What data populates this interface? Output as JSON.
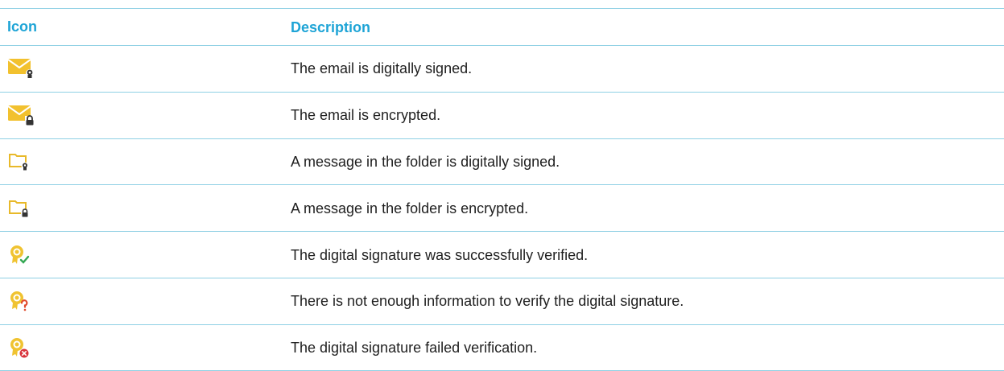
{
  "table": {
    "headers": {
      "icon": "Icon",
      "description": "Description"
    },
    "rows": [
      {
        "icon": "email-signed-icon",
        "description": "The email is digitally signed."
      },
      {
        "icon": "email-encrypted-icon",
        "description": "The email is encrypted."
      },
      {
        "icon": "folder-signed-icon",
        "description": "A message in the folder is digitally signed."
      },
      {
        "icon": "folder-encrypted-icon",
        "description": "A message in the folder is encrypted."
      },
      {
        "icon": "signature-verified-icon",
        "description": "The digital signature was successfully verified."
      },
      {
        "icon": "signature-unknown-icon",
        "description": "There is not enough information to verify the digital signature."
      },
      {
        "icon": "signature-failed-icon",
        "description": "The digital signature failed verification."
      }
    ]
  },
  "colors": {
    "header_text": "#1ea4d6",
    "rule": "#8fd0e4",
    "envelope": "#f2c12e",
    "folder": "#e8b92a",
    "ribbon": "#f0c331",
    "check": "#34a853",
    "question": "#e0492c",
    "error": "#d9363e"
  }
}
